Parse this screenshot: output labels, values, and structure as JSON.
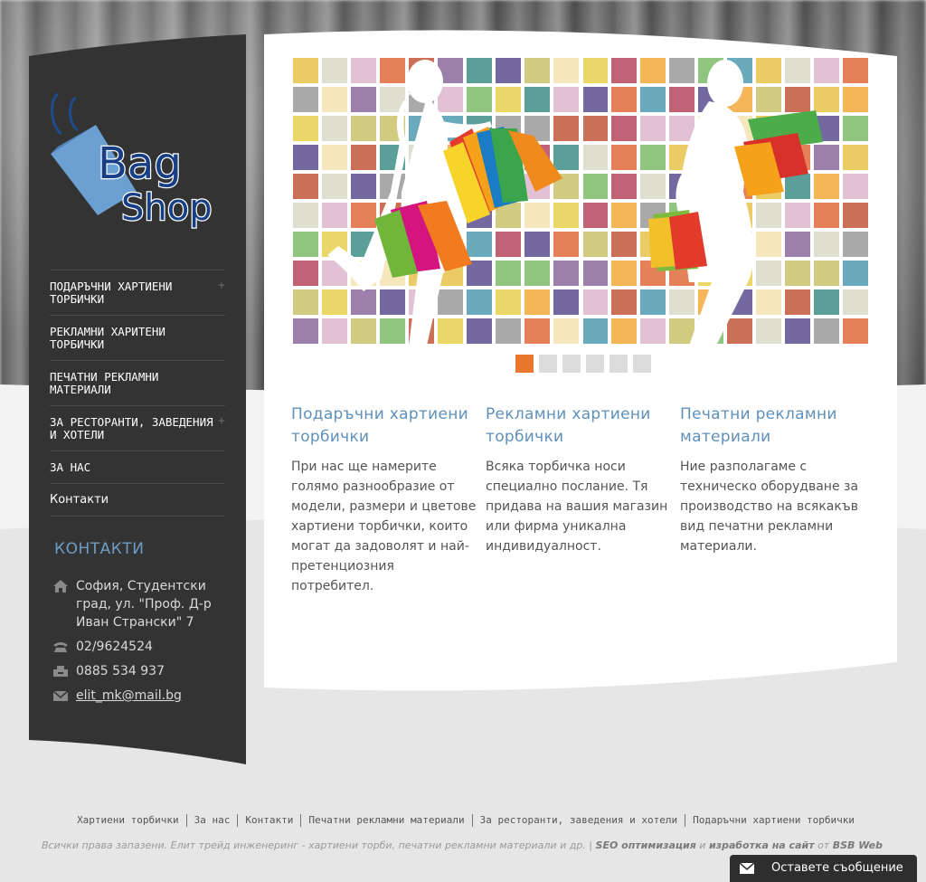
{
  "logo": {
    "line1": "Bag",
    "line2": "Shop"
  },
  "nav": [
    {
      "label": "ПОДАРЪЧНИ ХАРТИЕНИ ТОРБИЧКИ",
      "has_sub": true
    },
    {
      "label": "РЕКЛАМНИ ХАРИТЕНИ ТОРБИЧКИ",
      "has_sub": false
    },
    {
      "label": "ПЕЧАТНИ РЕКЛАМНИ МАТЕРИАЛИ",
      "has_sub": false
    },
    {
      "label": "ЗА РЕСТОРАНТИ, ЗАВЕДЕНИЯ И ХОТЕЛИ",
      "has_sub": true
    },
    {
      "label": "ЗА НАС",
      "has_sub": false
    },
    {
      "label": "Контакти",
      "has_sub": false
    }
  ],
  "nav_plus": "+",
  "contacts": {
    "title": "КОНТАКТИ",
    "address": "София, Студентски град, ул. \"Проф. Д-р Иван Странски\" 7",
    "phone": "02/9624524",
    "mobile": "0885 534 937",
    "email": "elit_mk@mail.bg"
  },
  "slider": {
    "total_slides": 6,
    "active_index": 0
  },
  "columns": [
    {
      "title": "Подаръчни хартиени торбички",
      "text": "При нас ще намерите голямо разнообразие от модели, размери и цветове хартиени торбички, които могат да задоволят и най-претенциозния потребител."
    },
    {
      "title": "Рекламни хартиени торбички",
      "text": "Всяка торбичка носи специално послание. Тя придава на вашия магазин или фирма уникална индивидуалност."
    },
    {
      "title": "Печатни рекламни материали",
      "text": "Ние разполагаме с техническо оборудване за производство на всякакъв вид печатни рекламни материали."
    }
  ],
  "footer": {
    "links": [
      "Хартиени торбички",
      "За нас",
      "Контакти",
      "Печатни рекламни материали",
      "За ресторанти, заведения и хотели",
      "Подаръчни хартиени торбички"
    ],
    "copyright_prefix": "Всички права запазени. Елит трейд инженеринг - хартиени торби, печатни рекламни материали и др. | ",
    "seo_text": "SEO оптимизация",
    "and_text": " и ",
    "dev_text": "изработка на сайт",
    "from_text": " от ",
    "company": "BSB Web"
  },
  "message_button": {
    "label": "Оставете съобщение"
  },
  "colors": {
    "accent_blue": "#5f90b9",
    "active_dot": "#e8762b",
    "sidebar_bg": "#333333"
  },
  "icons": [
    "home-icon",
    "phone-icon",
    "fax-icon",
    "mail-icon",
    "envelope-icon"
  ]
}
